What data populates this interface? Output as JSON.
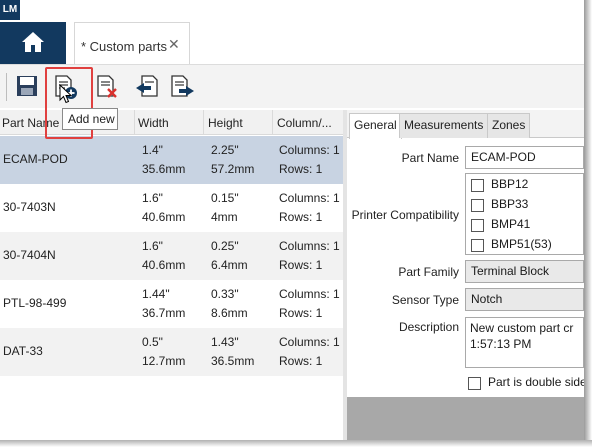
{
  "app": {
    "logo_text": "LM",
    "brand_color": "#12395f"
  },
  "tabs": [
    {
      "label": "* Custom parts",
      "close_glyph": "✕"
    }
  ],
  "toolbar": {
    "buttons": [
      {
        "icon": "save-icon"
      },
      {
        "icon": "add-new-icon",
        "tooltip": "Add new"
      },
      {
        "icon": "delete-icon"
      },
      {
        "icon": "import-icon"
      },
      {
        "icon": "export-icon"
      }
    ]
  },
  "grid": {
    "columns": [
      "Part Name",
      "Width",
      "Height",
      "Column/..."
    ],
    "rows": [
      {
        "name": "ECAM-POD",
        "width_in": "1.4\"",
        "width_mm": "35.6mm",
        "height_in": "2.25\"",
        "height_mm": "57.2mm",
        "columns": "Columns: 1",
        "rows": "Rows: 1",
        "selected": true
      },
      {
        "name": "30-7403N",
        "width_in": "1.6\"",
        "width_mm": "40.6mm",
        "height_in": "0.15\"",
        "height_mm": "4mm",
        "columns": "Columns: 1",
        "rows": "Rows: 1",
        "selected": false
      },
      {
        "name": "30-7404N",
        "width_in": "1.6\"",
        "width_mm": "40.6mm",
        "height_in": "0.25\"",
        "height_mm": "6.4mm",
        "columns": "Columns: 1",
        "rows": "Rows: 1",
        "selected": false
      },
      {
        "name": "PTL-98-499",
        "width_in": "1.44\"",
        "width_mm": "36.7mm",
        "height_in": "0.33\"",
        "height_mm": "8.6mm",
        "columns": "Columns: 1",
        "rows": "Rows: 1",
        "selected": false
      },
      {
        "name": "DAT-33",
        "width_in": "0.5\"",
        "width_mm": "12.7mm",
        "height_in": "1.43\"",
        "height_mm": "36.5mm",
        "columns": "Columns: 1",
        "rows": "Rows: 1",
        "selected": false
      }
    ]
  },
  "properties": {
    "tabs": [
      "General",
      "Measurements",
      "Zones"
    ],
    "active_tab": "General",
    "part_name_label": "Part Name",
    "part_name_value": "ECAM-POD",
    "printer_compat_label": "Printer Compatibility",
    "printers": [
      "BBP12",
      "BBP33",
      "BMP41",
      "BMP51(53)"
    ],
    "part_family_label": "Part Family",
    "part_family_value": "Terminal Block",
    "sensor_type_label": "Sensor Type",
    "sensor_type_value": "Notch",
    "description_label": "Description",
    "description_line1": "New custom part cr",
    "description_line2": "1:57:13 PM",
    "double_sided_label": "Part is double side"
  },
  "colors": {
    "selected_row": "#c8d3e2",
    "alt_row": "#f2f2f2",
    "highlight": "#e0403f"
  }
}
